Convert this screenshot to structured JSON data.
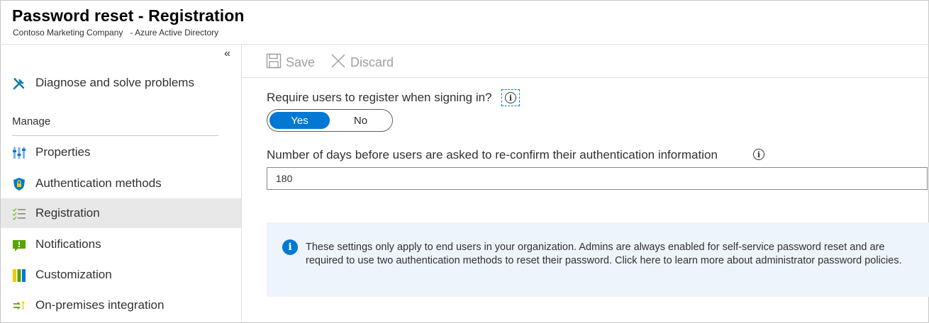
{
  "header": {
    "title": "Password reset - Registration",
    "subtitle": "Contoso Marketing Company   - Azure Active Directory"
  },
  "sidebar": {
    "collapse_glyph": "«",
    "diagnose": {
      "label": "Diagnose and solve problems",
      "icon": "wrench-screwdriver-icon"
    },
    "section": "Manage",
    "items": [
      {
        "label": "Properties",
        "icon": "properties-icon"
      },
      {
        "label": "Authentication methods",
        "icon": "shield-icon"
      },
      {
        "label": "Registration",
        "icon": "checklist-icon",
        "active": true
      },
      {
        "label": "Notifications",
        "icon": "notification-icon"
      },
      {
        "label": "Customization",
        "icon": "customization-icon"
      },
      {
        "label": "On-premises integration",
        "icon": "sync-icon"
      }
    ]
  },
  "toolbar": {
    "save_label": "Save",
    "discard_label": "Discard"
  },
  "form": {
    "require_register_label": "Require users to register when signing in?",
    "toggle_yes": "Yes",
    "toggle_no": "No",
    "toggle_selected": "Yes",
    "days_label": "Number of days before users are asked to re-confirm their authentication information",
    "days_value": "180"
  },
  "notice": {
    "text": "These settings only apply to end users in your organization. Admins are always enabled for self-service password reset and are required to use two authentication methods to reset their password. Click here to learn more about administrator password policies."
  },
  "colors": {
    "accent": "#0078d4",
    "active_nav": "#e8e8e8",
    "notice_bg": "#eef4fc"
  }
}
